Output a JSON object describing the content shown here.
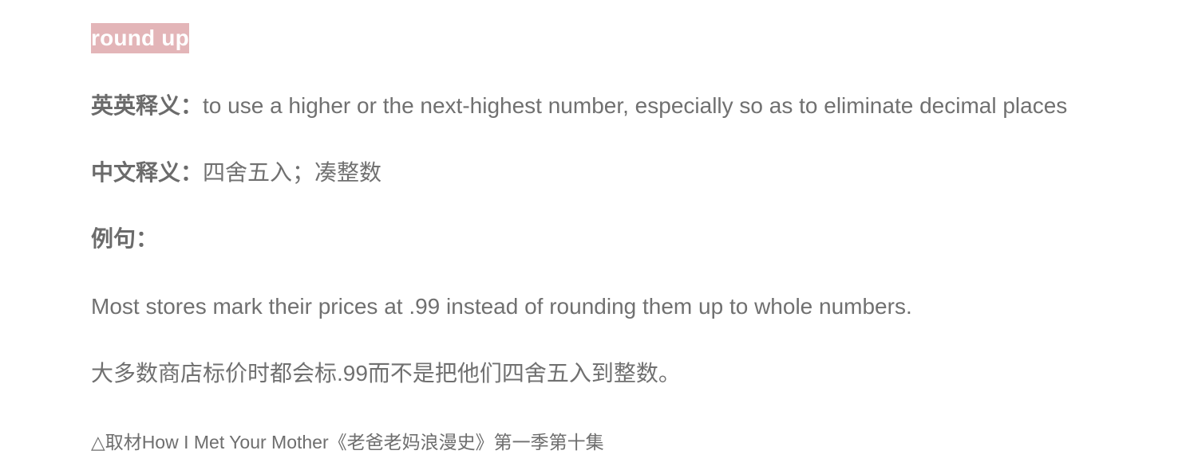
{
  "term": "round up",
  "definitions": {
    "english_label": "英英释义：",
    "english_text": "to use a higher or the next-highest number, especially so as to eliminate decimal places",
    "chinese_label": "中文释义：",
    "chinese_text": "四舍五入；凑整数"
  },
  "example": {
    "label": "例句：",
    "sentence_en": "Most stores mark their prices at .99 instead of rounding them up to whole numbers.",
    "sentence_cn": "大多数商店标价时都会标.99而不是把他们四舍五入到整数。"
  },
  "source": "△取材How I Met Your Mother《老爸老妈浪漫史》第一季第十集",
  "colors": {
    "highlight_background": "#e3b5b8",
    "highlight_text": "#ffffff",
    "body_text": "#6b6b6b"
  }
}
